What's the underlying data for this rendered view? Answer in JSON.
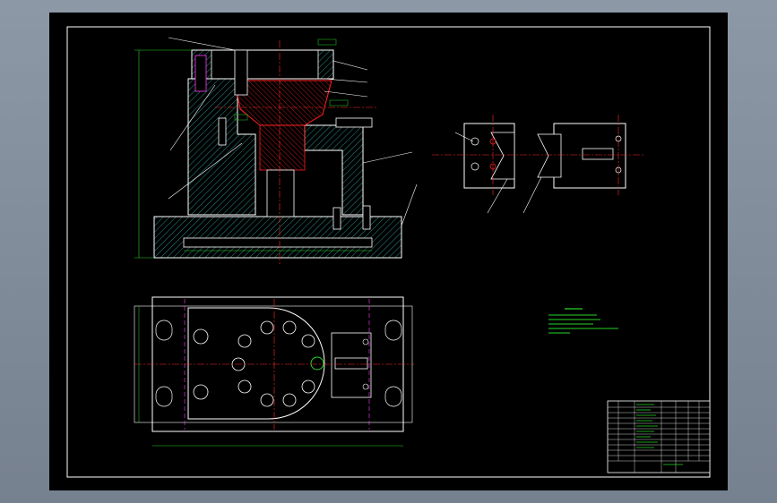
{
  "colors": {
    "background": "#000000",
    "frame": "#ffffff",
    "outline": "#ffffff",
    "hatch": "#2fb3a8",
    "centerline": "#ff2a2a",
    "hidden": "#ff3cff",
    "dimension": "#27d427",
    "annotation": "#27d427",
    "part": "#ff2020"
  },
  "title_block": {
    "rows": [
      "",
      "",
      "",
      "",
      "",
      "",
      "",
      "",
      "",
      "",
      "",
      ""
    ],
    "note_lines": [
      "",
      "",
      "",
      "",
      "",
      ""
    ]
  }
}
